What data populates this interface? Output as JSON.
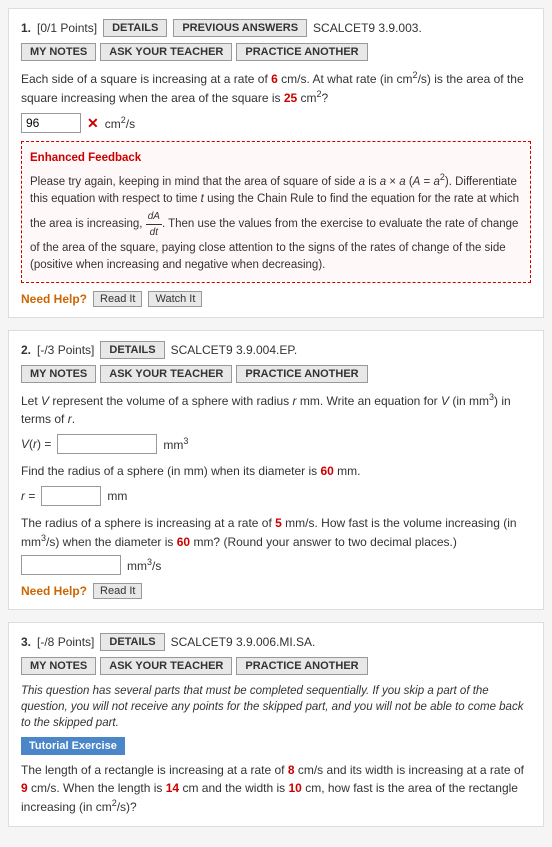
{
  "questions": [
    {
      "number": "1.",
      "points": "[0/1 Points]",
      "buttons": {
        "details": "DETAILS",
        "previous": "PREVIOUS ANSWERS",
        "scalcet": "SCALCET9 3.9.003.",
        "notes": "MY NOTES",
        "ask": "ASK YOUR TEACHER",
        "practice": "PRACTICE ANOTHER"
      },
      "body": "Each side of a square is increasing at a rate of 6 cm/s. At what rate (in cm²/s) is the area of the square increasing when the area of the square is 25 cm²?",
      "answer_value": "96",
      "answer_wrong": true,
      "answer_unit": "cm²/s",
      "feedback_title": "Enhanced Feedback",
      "feedback_body": "Please try again, keeping in mind that the area of square of side a is a × a (A = a²). Differentiate this equation with respect to time t using the Chain Rule to find the equation for the rate at which the area is increasing,",
      "feedback_body2": ". Then use the values from the exercise to evaluate the rate of change of the area of the square, paying close attention to the signs of the rates of change of the side (positive when increasing and negative when decreasing).",
      "need_help": "Need Help?",
      "read_btn": "Read It",
      "watch_btn": "Watch It"
    },
    {
      "number": "2.",
      "points": "[-/3 Points]",
      "buttons": {
        "details": "DETAILS",
        "scalcet": "SCALCET9 3.9.004.EP.",
        "notes": "MY NOTES",
        "ask": "ASK YOUR TEACHER",
        "practice": "PRACTICE ANOTHER"
      },
      "body1": "Let V represent the volume of a sphere with radius r mm. Write an equation for V (in mm³) in terms of r.",
      "input1_label": "V(r) =",
      "input1_unit": "mm³",
      "body2": "Find the radius of a sphere (in mm) when its diameter is 60 mm.",
      "input2_label": "r =",
      "input2_unit": "mm",
      "body3": "The radius of a sphere is increasing at a rate of 5 mm/s. How fast is the volume increasing (in mm³/s) when the diameter is 60 mm? (Round your answer to two decimal places.)",
      "input3_unit": "mm³/s",
      "need_help": "Need Help?",
      "read_btn": "Read It"
    },
    {
      "number": "3.",
      "points": "[-/8 Points]",
      "buttons": {
        "details": "DETAILS",
        "scalcet": "SCALCET9 3.9.006.MI.SA.",
        "notes": "MY NOTES",
        "ask": "ASK YOUR TEACHER",
        "practice": "PRACTICE ANOTHER"
      },
      "italic_note": "This question has several parts that must be completed sequentially. If you skip a part of the question, you will not receive any points for the skipped part, and you will not be able to come back to the skipped part.",
      "tutorial_label": "Tutorial Exercise",
      "body": "The length of a rectangle is increasing at a rate of 8 cm/s and its width is increasing at a rate of 9 cm/s. When the length is 14 cm and the width is 10 cm, how fast is the area of the rectangle increasing (in cm²/s)?"
    }
  ],
  "colors": {
    "accent_red": "#c00000",
    "accent_blue": "#0000aa",
    "btn_bg": "#e8e8e8",
    "feedback_border": "#cc0000",
    "need_help_color": "#cc6600",
    "tutorial_bg": "#4a86c8"
  }
}
